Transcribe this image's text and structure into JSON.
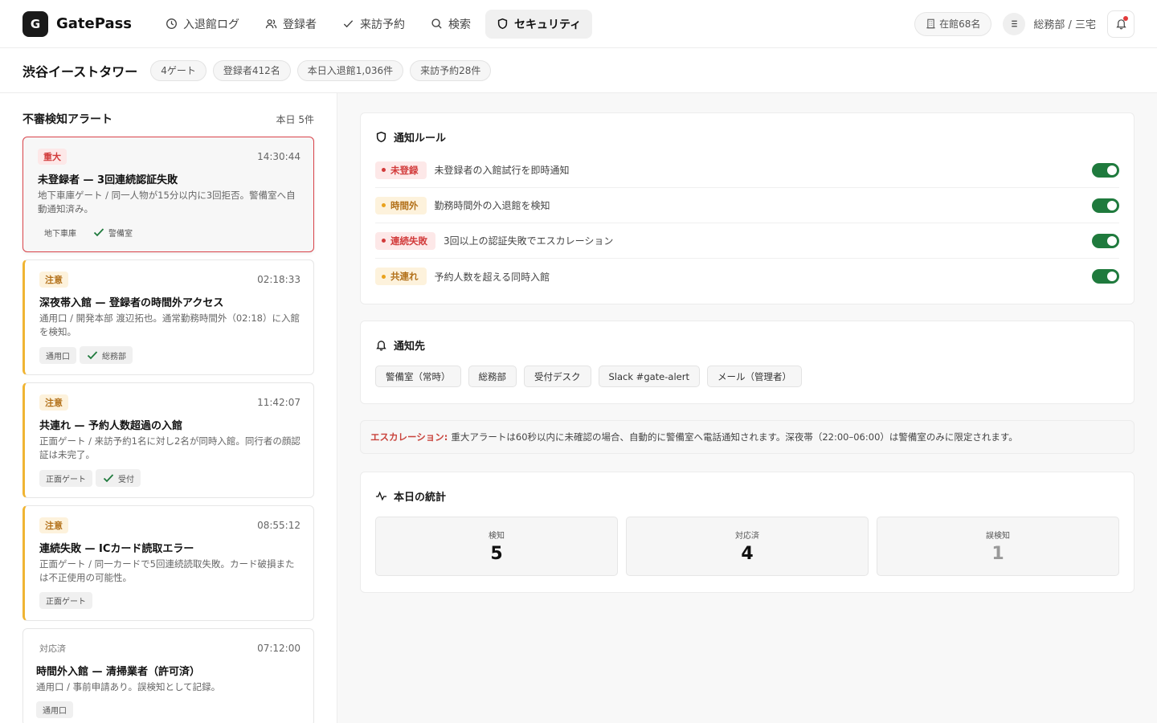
{
  "app": {
    "logo_letter": "G",
    "name": "GatePass"
  },
  "nav": [
    {
      "label": "入退館ログ",
      "icon": "clock-icon"
    },
    {
      "label": "登録者",
      "icon": "users-icon"
    },
    {
      "label": "来訪予約",
      "icon": "check-icon"
    },
    {
      "label": "検索",
      "icon": "search-icon"
    },
    {
      "label": "セキュリティ",
      "icon": "shield-icon",
      "active": true
    }
  ],
  "header": {
    "occupancy": "在館68名",
    "user": "総務部 / 三宅"
  },
  "subbar": {
    "building": "渋谷イーストタワー",
    "chips": [
      "4ゲート",
      "登録者412名",
      "本日入退館1,036件",
      "来訪予約28件"
    ]
  },
  "alerts_panel": {
    "title": "不審検知アラート",
    "count": "本日 5件",
    "items": [
      {
        "severity": "重大",
        "time": "14:30:44",
        "title": "未登録者 — 3回連続認証失敗",
        "desc": "地下車庫ゲート / 同一人物が15分以内に3回拒否。警備室へ自動通知済み。",
        "location": "地下車庫",
        "ack": "警備室"
      },
      {
        "severity": "注意",
        "time": "02:18:33",
        "title": "深夜帯入館 — 登録者の時間外アクセス",
        "desc": "通用口 / 開発本部 渡辺拓也。通常勤務時間外（02:18）に入館を検知。",
        "location": "通用口",
        "ack": "総務部"
      },
      {
        "severity": "注意",
        "time": "11:42:07",
        "title": "共連れ — 予約人数超過の入館",
        "desc": "正面ゲート / 来訪予約1名に対し2名が同時入館。同行者の顔認証は未完了。",
        "location": "正面ゲート",
        "ack": "受付"
      },
      {
        "severity": "注意",
        "time": "08:55:12",
        "title": "連続失敗 — ICカード読取エラー",
        "desc": "正面ゲート / 同一カードで5回連続読取失敗。カード破損または不正使用の可能性。",
        "location": "正面ゲート"
      },
      {
        "severity": "対応済",
        "time": "07:12:00",
        "title": "時間外入館 — 清掃業者（許可済）",
        "desc": "通用口 / 事前申請あり。誤検知として記録。",
        "location": "通用口"
      }
    ]
  },
  "rules": {
    "title": "通知ルール",
    "items": [
      {
        "badge": "未登録",
        "color": "red",
        "desc": "未登録者の入館試行を即時通知",
        "enabled": true
      },
      {
        "badge": "時間外",
        "color": "amber",
        "desc": "勤務時間外の入退館を検知",
        "enabled": true
      },
      {
        "badge": "連続失敗",
        "color": "red",
        "desc": "3回以上の認証失敗でエスカレーション",
        "enabled": true
      },
      {
        "badge": "共連れ",
        "color": "amber",
        "desc": "予約人数を超える同時入館",
        "enabled": true
      }
    ]
  },
  "recipients": {
    "title": "通知先",
    "items": [
      "警備室（常時）",
      "総務部",
      "受付デスク",
      "Slack #gate-alert",
      "メール（管理者）"
    ]
  },
  "escalation": {
    "label": "エスカレーション:",
    "text": "重大アラートは60秒以内に未確認の場合、自動的に警備室へ電話通知されます。深夜帯（22:00–06:00）は警備室のみに限定されます。"
  },
  "stats": {
    "title": "本日の統計",
    "items": [
      {
        "label": "検知",
        "value": "5"
      },
      {
        "label": "対応済",
        "value": "4"
      },
      {
        "label": "誤検知",
        "value": "1"
      }
    ]
  },
  "colors": {
    "critical": "#d23b3b",
    "warning": "#f0b432",
    "toggle_on": "#1f7a3d"
  }
}
